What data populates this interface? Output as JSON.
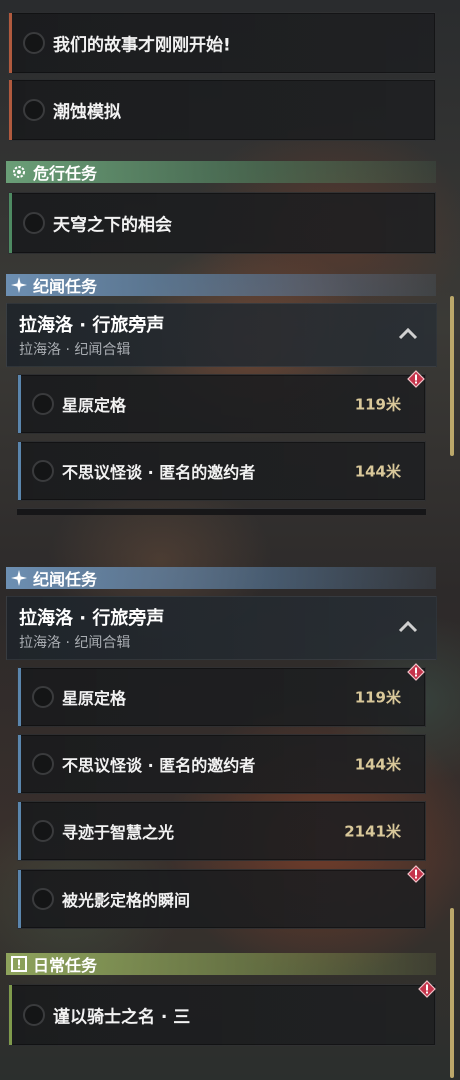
{
  "panel_top": {
    "quests_top": [
      {
        "name": "我们的故事才刚刚开始!"
      },
      {
        "name": "潮蚀模拟"
      }
    ],
    "danger_header": "危行任务",
    "danger_quest": {
      "name": "天穹之下的相会"
    },
    "chronicle_header": "纪闻任务",
    "group": {
      "title": "拉海洛 · 行旅旁声",
      "subtitle": "拉海洛 · 纪闻合辑"
    },
    "sub_quests": [
      {
        "name": "星原定格",
        "distance": "119米",
        "alert": true
      },
      {
        "name": "不思议怪谈 · 匿名的邀约者",
        "distance": "144米",
        "alert": false
      }
    ]
  },
  "panel_bottom": {
    "chronicle_header": "纪闻任务",
    "group": {
      "title": "拉海洛 · 行旅旁声",
      "subtitle": "拉海洛 · 纪闻合辑"
    },
    "sub_quests": [
      {
        "name": "星原定格",
        "distance": "119米",
        "alert": true
      },
      {
        "name": "不思议怪谈 · 匿名的邀约者",
        "distance": "144米",
        "alert": false
      },
      {
        "name": "寻迹于智慧之光",
        "distance": "2141米",
        "alert": false
      },
      {
        "name": "被光影定格的瞬间",
        "distance": "",
        "alert": true
      }
    ],
    "daily_header": "日常任务",
    "daily_quest": {
      "name": "谨以骑士之名 · 三",
      "alert": true
    }
  },
  "colors": {
    "danger": "#6a9e77",
    "chronicle": "#6d8fb2",
    "daily": "#8ea35c",
    "alert": "#c4334a",
    "distance": "#d9c89a"
  }
}
